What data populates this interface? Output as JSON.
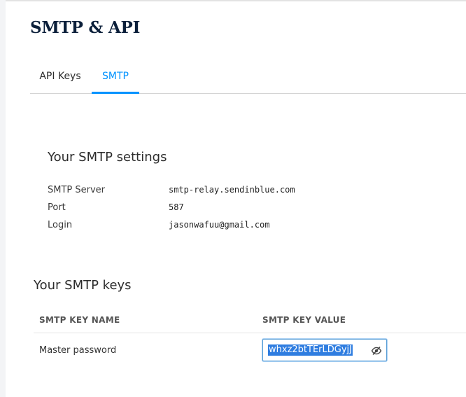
{
  "header": {
    "title": "SMTP & API"
  },
  "tabs": [
    {
      "label": "API Keys",
      "active": false
    },
    {
      "label": "SMTP",
      "active": true
    }
  ],
  "accent_color": "#0092ff",
  "smtp_settings": {
    "title": "Your SMTP settings",
    "rows": [
      {
        "label": "SMTP Server",
        "value": "smtp-relay.sendinblue.com"
      },
      {
        "label": "Port",
        "value": "587"
      },
      {
        "label": "Login",
        "value": "jasonwafuu@gmail.com"
      }
    ]
  },
  "smtp_keys": {
    "title": "Your SMTP keys",
    "columns": [
      "SMTP KEY NAME",
      "SMTP KEY VALUE"
    ],
    "rows": [
      {
        "name": "Master password",
        "value": "whxz2btTErLDGyjJ",
        "value_selected": true,
        "toggle_icon": "eye-slash-icon"
      }
    ]
  }
}
